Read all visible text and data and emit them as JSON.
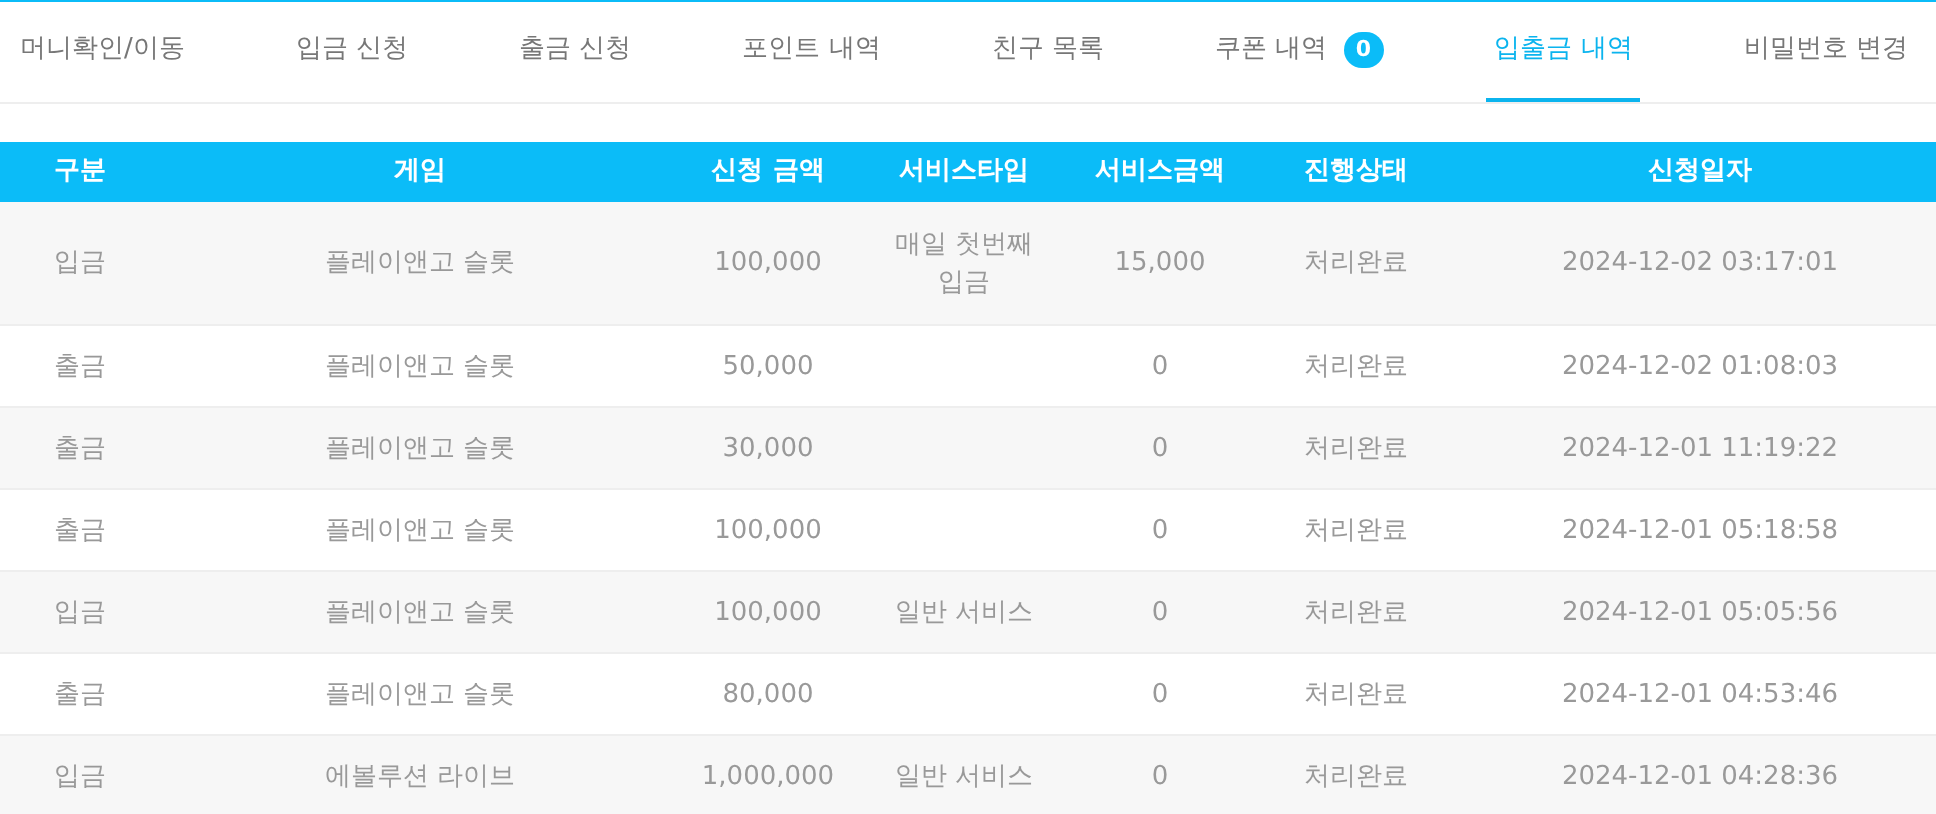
{
  "tabs": [
    {
      "label": "머니확인/이동",
      "selected": false
    },
    {
      "label": "입금 신청",
      "selected": false
    },
    {
      "label": "출금 신청",
      "selected": false
    },
    {
      "label": "포인트 내역",
      "selected": false
    },
    {
      "label": "친구 목록",
      "selected": false
    },
    {
      "label": "쿠폰 내역",
      "badge": "0",
      "selected": false
    },
    {
      "label": "입출금 내역",
      "selected": true
    },
    {
      "label": "비밀번호 변경",
      "selected": false
    }
  ],
  "table": {
    "columns": [
      "구분",
      "게임",
      "신청 금액",
      "서비스타입",
      "서비스금액",
      "진행상태",
      "신청일자"
    ],
    "rows": [
      {
        "type": "입금",
        "game": "플레이앤고 슬롯",
        "amount": "100,000",
        "service_type": "매일 첫번째 입금",
        "service_amount": "15,000",
        "status": "처리완료",
        "date": "2024-12-02 03:17:01"
      },
      {
        "type": "출금",
        "game": "플레이앤고 슬롯",
        "amount": "50,000",
        "service_amount": "0",
        "status": "처리완료",
        "date": "2024-12-02 01:08:03"
      },
      {
        "type": "출금",
        "game": "플레이앤고 슬롯",
        "amount": "30,000",
        "service_amount": "0",
        "status": "처리완료",
        "date": "2024-12-01 11:19:22"
      },
      {
        "type": "출금",
        "game": "플레이앤고 슬롯",
        "amount": "100,000",
        "service_amount": "0",
        "status": "처리완료",
        "date": "2024-12-01 05:18:58"
      },
      {
        "type": "입금",
        "game": "플레이앤고 슬롯",
        "amount": "100,000",
        "service_type": "일반 서비스",
        "service_amount": "0",
        "status": "처리완료",
        "date": "2024-12-01 05:05:56"
      },
      {
        "type": "출금",
        "game": "플레이앤고 슬롯",
        "amount": "80,000",
        "service_amount": "0",
        "status": "처리완료",
        "date": "2024-12-01 04:53:46"
      },
      {
        "type": "입금",
        "game": "에볼루션 라이브",
        "amount": "1,000,000",
        "service_type": "일반 서비스",
        "service_amount": "0",
        "status": "처리완료",
        "date": "2024-12-01 04:28:36"
      }
    ]
  }
}
